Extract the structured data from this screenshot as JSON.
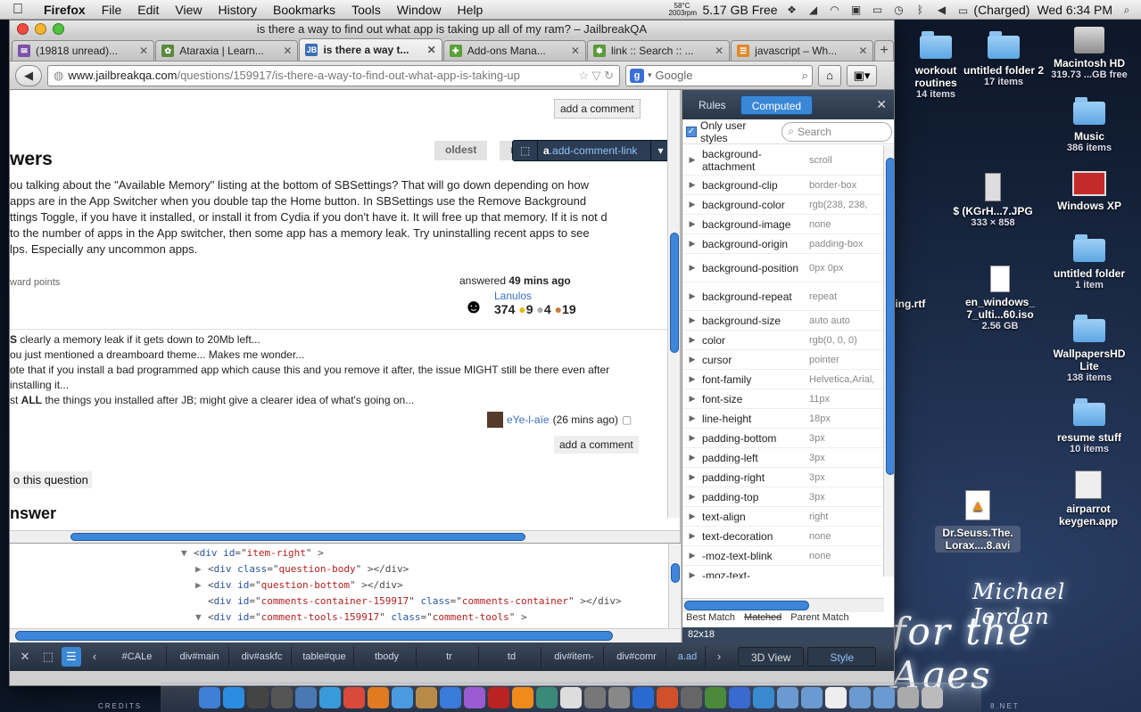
{
  "menubar": {
    "apple": "",
    "app": "Firefox",
    "items": [
      "File",
      "Edit",
      "View",
      "History",
      "Bookmarks",
      "Tools",
      "Window",
      "Help"
    ],
    "temp_line1": "58°C",
    "temp_line2": "2003rpm",
    "memory": "5.17 GB Free",
    "battery": "(Charged)",
    "clock": "Wed 6:34 PM"
  },
  "window": {
    "title": "is there a way to find out what app is taking up all of my ram? – JailbreakQA"
  },
  "tabs": [
    {
      "label": "(19818 unread)...",
      "icon": "mail-icon",
      "color": "#7b52a8"
    },
    {
      "label": "Ataraxia | Learn...",
      "icon": "leaf-icon",
      "color": "#5a8a3c"
    },
    {
      "label": "is there a way t...",
      "icon": "jb-icon",
      "color": "#3a6fb5",
      "fav_text": "JB",
      "active": true
    },
    {
      "label": "Add-ons Mana...",
      "icon": "puzzle-icon",
      "color": "#5aa03a"
    },
    {
      "label": "link :: Search :: ...",
      "icon": "paw-icon",
      "color": "#5a9a3a"
    },
    {
      "label": "javascript – Wh...",
      "icon": "so-icon",
      "color": "#e0882b"
    }
  ],
  "nav": {
    "url_domain": "www.jailbreakqa.com",
    "url_path": "/questions/159917/is-there-a-way-to-find-out-what-app-is-taking-up",
    "search_placeholder": "Google"
  },
  "page": {
    "add_comment_top": "add a comment",
    "answers_title": "wers",
    "sort_oldest": "oldest",
    "sort_newest": "ne",
    "answer_text": "ou talking about the \"Available Memory\" listing at the bottom of SBSettings? That will go down depending on how apps are in the App Switcher when you double tap the Home button. In SBSettings use the Remove Background ttings Toggle, if you have it installed, or install it from Cydia if you don't have it. It will free up that memory. If it is not d to the number of apps in the App switcher, then some app has a memory leak. Try uninstalling recent apps to see lps. Especially any uncommon apps.",
    "reward": "ward points",
    "answered_label": "answered",
    "answered_time": "49 mins ago",
    "user_name": "Lanulos",
    "user_rep": "374",
    "badge_gold": "9",
    "badge_silver": "4",
    "badge_bronze": "19",
    "comment1_bold": "S",
    "comment1": " clearly a memory leak if it gets down to 20Mb left...",
    "comment2": "ou just mentioned a dreamboard theme... Makes me wonder...",
    "comment3": "ote that if you install a bad programmed app which cause this and you remove it after, the issue MIGHT still be there even after",
    "comment4": "installing it...",
    "comment5_pre": "st ",
    "comment5_bold": "ALL",
    "comment5": " the things you installed after JB; might give a clearer idea of what's going on...",
    "comment_author": "eYe-l-aïe",
    "comment_time": "(26 mins ago)",
    "add_comment_bottom": "add a comment",
    "answer_question": "o this question",
    "your_answer_partial": "nswer"
  },
  "inspector": {
    "bubble_tag": "a",
    "bubble_class": ".add-comment-link",
    "html_lines": [
      {
        "tag": "div",
        "attrs": [
          [
            "id",
            "item-right"
          ]
        ],
        "suffix": ">",
        "twisty": "▼"
      },
      {
        "tag": "div",
        "attrs": [
          [
            "class",
            "question-body"
          ]
        ],
        "suffix": "></div>",
        "twisty": "▶"
      },
      {
        "tag": "div",
        "attrs": [
          [
            "id",
            "question-bottom"
          ]
        ],
        "suffix": "></div>",
        "twisty": "▶"
      },
      {
        "tag": "div",
        "attrs": [
          [
            "id",
            "comments-container-159917"
          ],
          [
            "class",
            "comments-container"
          ]
        ],
        "suffix": "></div>",
        "twisty": ""
      },
      {
        "tag": "div",
        "attrs": [
          [
            "id",
            "comment-tools-159917"
          ],
          [
            "class",
            "comment-tools"
          ]
        ],
        "suffix": ">",
        "twisty": "▼"
      }
    ],
    "rules_tab": "Rules",
    "computed_tab": "Computed",
    "only_user_styles": "Only user styles",
    "search_placeholder": "Search",
    "properties": [
      {
        "name": "background-attachment",
        "value": "scroll"
      },
      {
        "name": "background-clip",
        "value": "border-box"
      },
      {
        "name": "background-color",
        "value": "rgb(238, 238,"
      },
      {
        "name": "background-image",
        "value": "none"
      },
      {
        "name": "background-origin",
        "value": "padding-box"
      },
      {
        "name": "background-position",
        "value": "0px 0px"
      },
      {
        "name": "background-repeat",
        "value": "repeat"
      },
      {
        "name": "background-size",
        "value": "auto auto"
      },
      {
        "name": "color",
        "value": "rgb(0, 0, 0)"
      },
      {
        "name": "cursor",
        "value": "pointer"
      },
      {
        "name": "font-family",
        "value": "Helvetica,Arial,"
      },
      {
        "name": "font-size",
        "value": "11px"
      },
      {
        "name": "line-height",
        "value": "18px"
      },
      {
        "name": "padding-bottom",
        "value": "3px"
      },
      {
        "name": "padding-left",
        "value": "3px"
      },
      {
        "name": "padding-right",
        "value": "3px"
      },
      {
        "name": "padding-top",
        "value": "3px"
      },
      {
        "name": "text-align",
        "value": "right"
      },
      {
        "name": "text-decoration",
        "value": "none"
      },
      {
        "name": "-moz-text-blink",
        "value": "none"
      },
      {
        "name": "-moz-text-",
        "value": ""
      }
    ],
    "best_match": "Best Match",
    "matched": "Matched",
    "parent_match": "Parent Match",
    "element_size": "82x18",
    "breadcrumbs": [
      "#CALe",
      "div#main",
      "div#askfc",
      "table#que",
      "tbody",
      "tr",
      "td",
      "div#item-",
      "div#comr",
      "a.ad"
    ],
    "view_3d": "3D View",
    "style_btn": "Style"
  },
  "desktop": {
    "icons": [
      {
        "name": "workout routines",
        "sub": "14 items",
        "kind": "folder"
      },
      {
        "name": "untitled folder 2",
        "sub": "17 items",
        "kind": "folder"
      },
      {
        "name": "Macintosh HD",
        "sub": "319.73 ...GB free",
        "kind": "hd"
      },
      {
        "name": "Music",
        "sub": "386 items",
        "kind": "folder"
      },
      {
        "name": "$ (KGrH...7.JPG",
        "sub": "333 × 858",
        "kind": "image"
      },
      {
        "name": "Windows XP",
        "sub": "",
        "kind": "xp"
      },
      {
        "name": "ding.rtf",
        "sub": "",
        "kind": "doc"
      },
      {
        "name": "en_windows_ 7_ulti...60.iso",
        "sub": "2.56 GB",
        "kind": "doc"
      },
      {
        "name": "untitled folder",
        "sub": "1 item",
        "kind": "folder"
      },
      {
        "name": "WallpapersHD Lite",
        "sub": "138 items",
        "kind": "folder"
      },
      {
        "name": "resume stuff",
        "sub": "10 items",
        "kind": "folder"
      },
      {
        "name": "Dr.Seuss.The. Lorax....8.avi",
        "sub": "",
        "kind": "avi"
      },
      {
        "name": "airparrot keygen.app",
        "sub": "",
        "kind": "app"
      }
    ],
    "wallpaper_line1": "Michael Jordan",
    "wallpaper_line2": "for the Ages",
    "credits": "CREDITS",
    "credits_right": "8.NET"
  },
  "dock": [
    {
      "icon": "finder-icon",
      "color": "#3f7fd6"
    },
    {
      "icon": "appstore-icon",
      "color": "#2b8de0"
    },
    {
      "icon": "dashboard-icon",
      "color": "#444"
    },
    {
      "icon": "launchpad-icon",
      "color": "#555"
    },
    {
      "icon": "preview-icon",
      "color": "#4a78b5"
    },
    {
      "icon": "safari-icon",
      "color": "#3a9ad9"
    },
    {
      "icon": "chrome-icon",
      "color": "#d94a3a"
    },
    {
      "icon": "firefox-icon",
      "color": "#e07b22"
    },
    {
      "icon": "ichat-icon",
      "color": "#4a9ae0"
    },
    {
      "icon": "addressbook-icon",
      "color": "#b88a4a"
    },
    {
      "icon": "itunes-icon",
      "color": "#3a7ad9"
    },
    {
      "icon": "vlc-like-icon",
      "color": "#9a5ad0"
    },
    {
      "icon": "photobooth-icon",
      "color": "#b22"
    },
    {
      "icon": "vlc-icon",
      "color": "#f08a1a"
    },
    {
      "icon": "timemachine-icon",
      "color": "#3a8a7a"
    },
    {
      "icon": "notes-icon",
      "color": "#ddd"
    },
    {
      "icon": "camera-icon",
      "color": "#777"
    },
    {
      "icon": "transmission-icon",
      "color": "#888"
    },
    {
      "icon": "word-icon",
      "color": "#2a6ad0"
    },
    {
      "icon": "powerpoint-icon",
      "color": "#d0502a"
    },
    {
      "icon": "calculator-icon",
      "color": "#666"
    },
    {
      "icon": "activity-icon",
      "color": "#4a8a3a"
    },
    {
      "icon": "people-icon",
      "color": "#3a6ad0"
    },
    {
      "icon": "spotlight-icon",
      "color": "#3a8ad0"
    },
    {
      "icon": "apps-folder-icon",
      "color": "#6a9ad0"
    },
    {
      "icon": "docs-folder-icon",
      "color": "#6a9ad0"
    },
    {
      "icon": "document-icon",
      "color": "#eee"
    },
    {
      "icon": "downloads-folder-icon",
      "color": "#6a9ad0"
    },
    {
      "icon": "stack-folder-icon",
      "color": "#6a9ad0"
    },
    {
      "icon": "list-icon",
      "color": "#aaa"
    },
    {
      "icon": "trash-icon",
      "color": "#bbb"
    }
  ]
}
